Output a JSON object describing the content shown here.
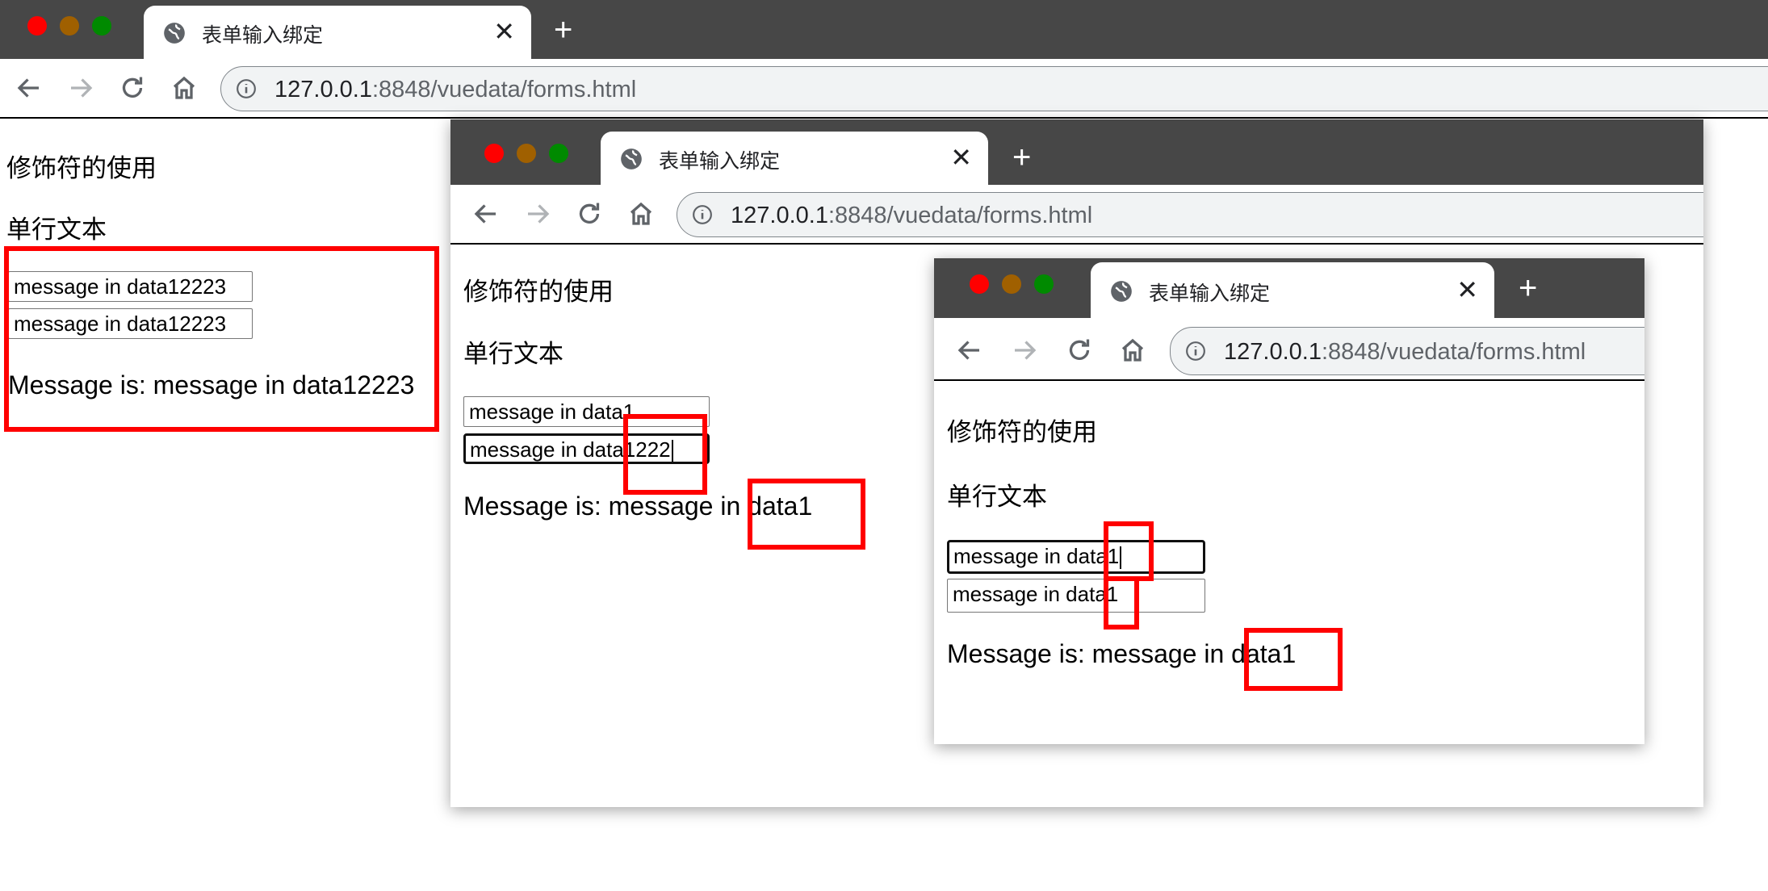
{
  "browser": {
    "tab_title": "表单输入绑定",
    "new_tab": "+",
    "close": "✕",
    "url_host": "127.0.0.1",
    "url_rest": ":8848/vuedata/forms.html"
  },
  "page": {
    "heading": "修饰符的使用",
    "section": "单行文本"
  },
  "states": [
    {
      "input1": "message in data12223",
      "input2": "message in data12223",
      "message": "Message is: message in data12223"
    },
    {
      "input1": "message in data1",
      "input2": "message in data1222",
      "message": "Message is: message in data1"
    },
    {
      "input1": "message in data1",
      "input2": "message in data1",
      "message": "Message is: message in data1"
    }
  ],
  "colors": {
    "highlight": "#ff0000",
    "tabbar": "#474747",
    "close_light": "#ff0000",
    "min_light": "#a06000",
    "max_light": "#008a00"
  }
}
